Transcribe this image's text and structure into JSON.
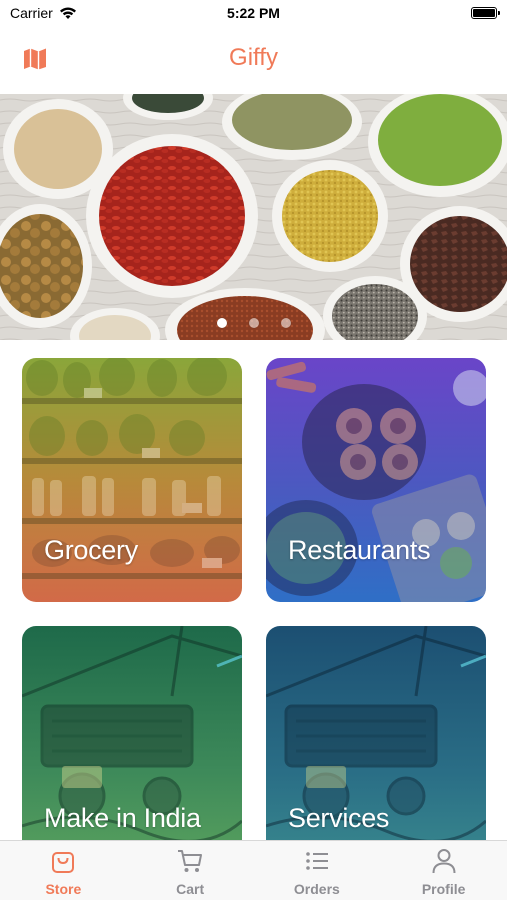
{
  "status_bar": {
    "carrier": "Carrier",
    "time": "5:22 PM"
  },
  "nav": {
    "title": "Giffy",
    "left_icon": "map-icon"
  },
  "banner": {
    "page_count": 3,
    "current_page": 1
  },
  "categories": [
    {
      "label": "Grocery"
    },
    {
      "label": "Restaurants"
    },
    {
      "label": "Make in India"
    },
    {
      "label": "Services"
    }
  ],
  "tabs": [
    {
      "label": "Store",
      "icon": "bag-icon",
      "active": true
    },
    {
      "label": "Cart",
      "icon": "cart-icon",
      "active": false
    },
    {
      "label": "Orders",
      "icon": "list-icon",
      "active": false
    },
    {
      "label": "Profile",
      "icon": "person-icon",
      "active": false
    }
  ],
  "colors": {
    "accent": "#f07a58",
    "inactive": "#8e8e93"
  }
}
